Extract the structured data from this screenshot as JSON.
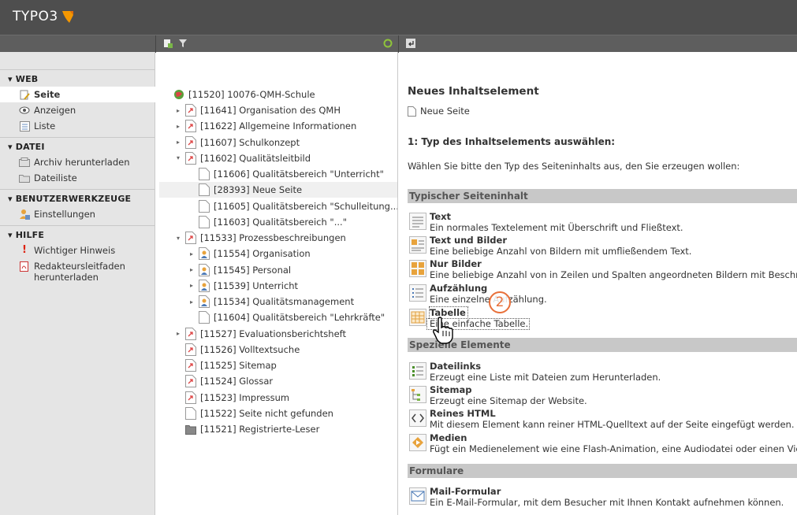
{
  "app": {
    "logo": "TYPO3"
  },
  "nav": {
    "sections": [
      {
        "title": "▾ WEB",
        "items": [
          {
            "label": "Seite",
            "icon": "page-module-icon",
            "active": true
          },
          {
            "label": "Anzeigen",
            "icon": "eye-icon"
          },
          {
            "label": "Liste",
            "icon": "list-icon"
          }
        ]
      },
      {
        "title": "▾ DATEI",
        "items": [
          {
            "label": "Archiv herunterladen",
            "icon": "archive-icon"
          },
          {
            "label": "Dateiliste",
            "icon": "folder-icon"
          }
        ]
      },
      {
        "title": "▾ BENUTZERWERKZEUGE",
        "items": [
          {
            "label": "Einstellungen",
            "icon": "user-settings-icon"
          }
        ]
      },
      {
        "title": "▾ HILFE",
        "items": [
          {
            "label": "Wichtiger Hinweis",
            "icon": "exclamation-icon"
          },
          {
            "label": "Redakteursleitfaden herunterladen",
            "icon": "pdf-icon"
          }
        ]
      }
    ]
  },
  "tree": {
    "root": "[11520] 10076-QMH-Schule",
    "nodes": [
      {
        "label": "[11641] Organisation des QMH",
        "level": 1,
        "arrow": "▸",
        "icon": "shortcut"
      },
      {
        "label": "[11622] Allgemeine Informationen",
        "level": 1,
        "arrow": "▸",
        "icon": "shortcut"
      },
      {
        "label": "[11607] Schulkonzept",
        "level": 1,
        "arrow": "▸",
        "icon": "shortcut"
      },
      {
        "label": "[11602] Qualitätsleitbild",
        "level": 1,
        "arrow": "▾",
        "icon": "shortcut"
      },
      {
        "label": "[11606] Qualitätsbereich \"Unterricht\"",
        "level": 2,
        "arrow": "",
        "icon": "page"
      },
      {
        "label": "[28393] Neue Seite",
        "level": 2,
        "arrow": "",
        "icon": "page",
        "selected": true
      },
      {
        "label": "[11605] Qualitätsbereich \"Schulleitung...",
        "level": 2,
        "arrow": "",
        "icon": "page"
      },
      {
        "label": "[11603] Qualitätsbereich \"...\"",
        "level": 2,
        "arrow": "",
        "icon": "page"
      },
      {
        "label": "[11533] Prozessbeschreibungen",
        "level": 1,
        "arrow": "▾",
        "icon": "shortcut"
      },
      {
        "label": "[11554] Organisation",
        "level": 2,
        "arrow": "▸",
        "icon": "user"
      },
      {
        "label": "[11545] Personal",
        "level": 2,
        "arrow": "▸",
        "icon": "user"
      },
      {
        "label": "[11539] Unterricht",
        "level": 2,
        "arrow": "▸",
        "icon": "user"
      },
      {
        "label": "[11534] Qualitätsmanagement",
        "level": 2,
        "arrow": "▸",
        "icon": "user"
      },
      {
        "label": "[11604] Qualitätsbereich \"Lehrkräfte\"",
        "level": 2,
        "arrow": "",
        "icon": "page"
      },
      {
        "label": "[11527] Evaluationsberichtsheft",
        "level": 1,
        "arrow": "▸",
        "icon": "shortcut"
      },
      {
        "label": "[11526] Volltextsuche",
        "level": 1,
        "arrow": "",
        "icon": "shortcut"
      },
      {
        "label": "[11525] Sitemap",
        "level": 1,
        "arrow": "",
        "icon": "shortcut"
      },
      {
        "label": "[11524] Glossar",
        "level": 1,
        "arrow": "",
        "icon": "shortcut"
      },
      {
        "label": "[11523] Impressum",
        "level": 1,
        "arrow": "",
        "icon": "shortcut"
      },
      {
        "label": "[11522] Seite nicht gefunden",
        "level": 1,
        "arrow": "",
        "icon": "page"
      },
      {
        "label": "[11521] Registrierte-Leser",
        "level": 1,
        "arrow": "",
        "icon": "folder"
      }
    ]
  },
  "content": {
    "title": "Neues Inhaltselement",
    "page": "Neue Seite",
    "step": "1: Typ des Inhaltselements auswählen:",
    "intro": "Wählen Sie bitte den Typ des Seiteninhalts aus, den Sie erzeugen wollen:",
    "groups": [
      "Typischer Seiteninhalt",
      "Spezielle Elemente",
      "Formulare"
    ],
    "elements": [
      {
        "title": "Text",
        "desc": "Ein normales Textelement mit Überschrift und Fließtext.",
        "icon": "text-icon"
      },
      {
        "title": "Text und Bilder",
        "desc": "Eine beliebige Anzahl von Bildern mit umfließendem Text.",
        "icon": "text-images-icon"
      },
      {
        "title": "Nur Bilder",
        "desc": "Eine beliebige Anzahl von in Zeilen und Spalten angeordneten Bildern mit Beschr",
        "icon": "images-icon"
      },
      {
        "title": "Aufzählung",
        "desc": "Eine einzelne Aufzählung.",
        "icon": "bullets-icon"
      },
      {
        "title": "Tabelle",
        "desc": "Eine einfache Tabelle.",
        "icon": "table-icon"
      },
      {
        "title": "Dateilinks",
        "desc": "Erzeugt eine Liste mit Dateien zum Herunterladen.",
        "icon": "filelinks-icon"
      },
      {
        "title": "Sitemap",
        "desc": "Erzeugt eine Sitemap der Website.",
        "icon": "sitemap-icon"
      },
      {
        "title": "Reines HTML",
        "desc": "Mit diesem Element kann reiner HTML-Quelltext auf der Seite eingefügt werden.",
        "icon": "html-icon"
      },
      {
        "title": "Medien",
        "desc": "Fügt ein Medienelement wie eine Flash-Animation, eine Audiodatei oder einen Vic",
        "icon": "media-icon"
      },
      {
        "title": "Mail-Formular",
        "desc": "Ein E-Mail-Formular, mit dem Besucher mit Ihnen Kontakt aufnehmen können.",
        "icon": "mailform-icon"
      }
    ]
  },
  "callout": "2",
  "colors": {
    "topbar": "#4e4e4e",
    "toolbar": "#5e5e5e",
    "accent": "#e8703a",
    "group": "#c8c8c8"
  }
}
